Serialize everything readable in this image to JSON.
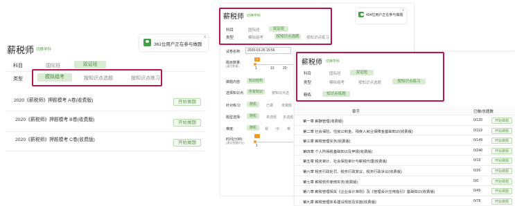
{
  "left_panel": {
    "title": "薪税师",
    "switch_subject": "切换学科",
    "toast_text": "361位用户正在参与做题",
    "toast_close": "X",
    "subject_label": "科目",
    "subject_tabs": [
      "国际班",
      "双证班"
    ],
    "type_label": "类型",
    "type_tabs": [
      "模拟组考",
      "按知识点选题",
      "按知识点练习"
    ],
    "exams": [
      {
        "name": "2020《薪税师》押题模考 A卷(收费版)",
        "button": "开始做题"
      },
      {
        "name": "2020《薪税师》押题模考 B卷(收费版)",
        "button": "开始做题"
      },
      {
        "name": "2020《薪税师》押题模考 C卷(收费版)",
        "button": "开始做题"
      }
    ]
  },
  "middle_panel": {
    "title": "薪税师",
    "switch_subject": "切换学科",
    "subject_label": "科目",
    "subject_tabs": [
      "国际班",
      "双证班"
    ],
    "type_label": "类型",
    "type_tabs": [
      "模拟组考",
      "按知识点选题",
      "按知识点练习"
    ],
    "toast_text": "404位用户正在参与做题",
    "toast_close": "X",
    "form": {
      "exam_name_label": "试卷名称:",
      "exam_name_value": "2020-03-26 15:56",
      "count_label": "题目数量:",
      "count_hint": "(道目数量)",
      "count_value": "1",
      "count_ticks": [
        "1",
        "10",
        "20"
      ],
      "content_label": "做题内容:",
      "content_option": "知识结构",
      "knowledge_label": "选择知识点:",
      "knowledge_options": [
        "所有知识",
        "按知识点选"
      ],
      "target_label": "针对练习:",
      "target_options": [
        "随机",
        "已做",
        "未做题"
      ],
      "qtype_label": "题型选择:",
      "qtype_options": [
        "随机",
        "单选题",
        "多选题"
      ],
      "difficulty_label": "难度:",
      "difficulty_options": [
        "随机",
        "易",
        "中",
        "难"
      ],
      "time_label": "时间(分钟):",
      "time_hint": "(建议答题时长)",
      "time_value": "1"
    }
  },
  "right_panel": {
    "title": "薪税师",
    "switch_subject": "切换学科",
    "subject_label": "科目",
    "subject_tabs": [
      "国际班",
      "双证班"
    ],
    "type_label": "类型",
    "type_tabs": [
      "模拟组考",
      "按知识点选题",
      "按知识点练习"
    ],
    "scope_label": "精练",
    "scope_tab": "知识点练题",
    "table_headers": [
      "章节",
      "已做/总题数"
    ],
    "chapters": [
      {
        "name": "第一章 薪酬管理(收费版)",
        "progress": "0/120",
        "button": "开始做题"
      },
      {
        "name": "第二章 社会保险、住房公积金、残疾人就业保障金基础知识(收费版)",
        "progress": "0/119",
        "button": "开始做题"
      },
      {
        "name": "第三章 薪税管理实务(收费版)",
        "progress": "0/149",
        "button": "开始做题"
      },
      {
        "name": "第四章 个人所得税基础知识及申报(收费版)",
        "progress": "0/240",
        "button": "开始做题"
      },
      {
        "name": "第五章 税务审计、社会保险审计与薪税代理(收费版)",
        "progress": "0/19",
        "button": "开始做题"
      },
      {
        "name": "第六章 税务行政处罚、税务行政复议、税务行政诉讼(收费版)",
        "progress": "0/26",
        "button": "开始做题"
      },
      {
        "name": "第七章 薪税软件使用实务(收费版)",
        "progress": "0/0",
        "button": "开始做题"
      },
      {
        "name": "第八章 薪税管理相关《企业会计准则》及《管理会计应用指引》基础知识(收费版)",
        "progress": "0/49",
        "button": "开始做题"
      },
      {
        "name": "第九章 薪税管理体系建设规划及实施(收费版)",
        "progress": "0/78",
        "button": "开始做题"
      }
    ]
  },
  "colors": {
    "accent_green": "#5a9b4a",
    "highlight_red": "#b8154a",
    "flag_orange": "#f09a27"
  }
}
